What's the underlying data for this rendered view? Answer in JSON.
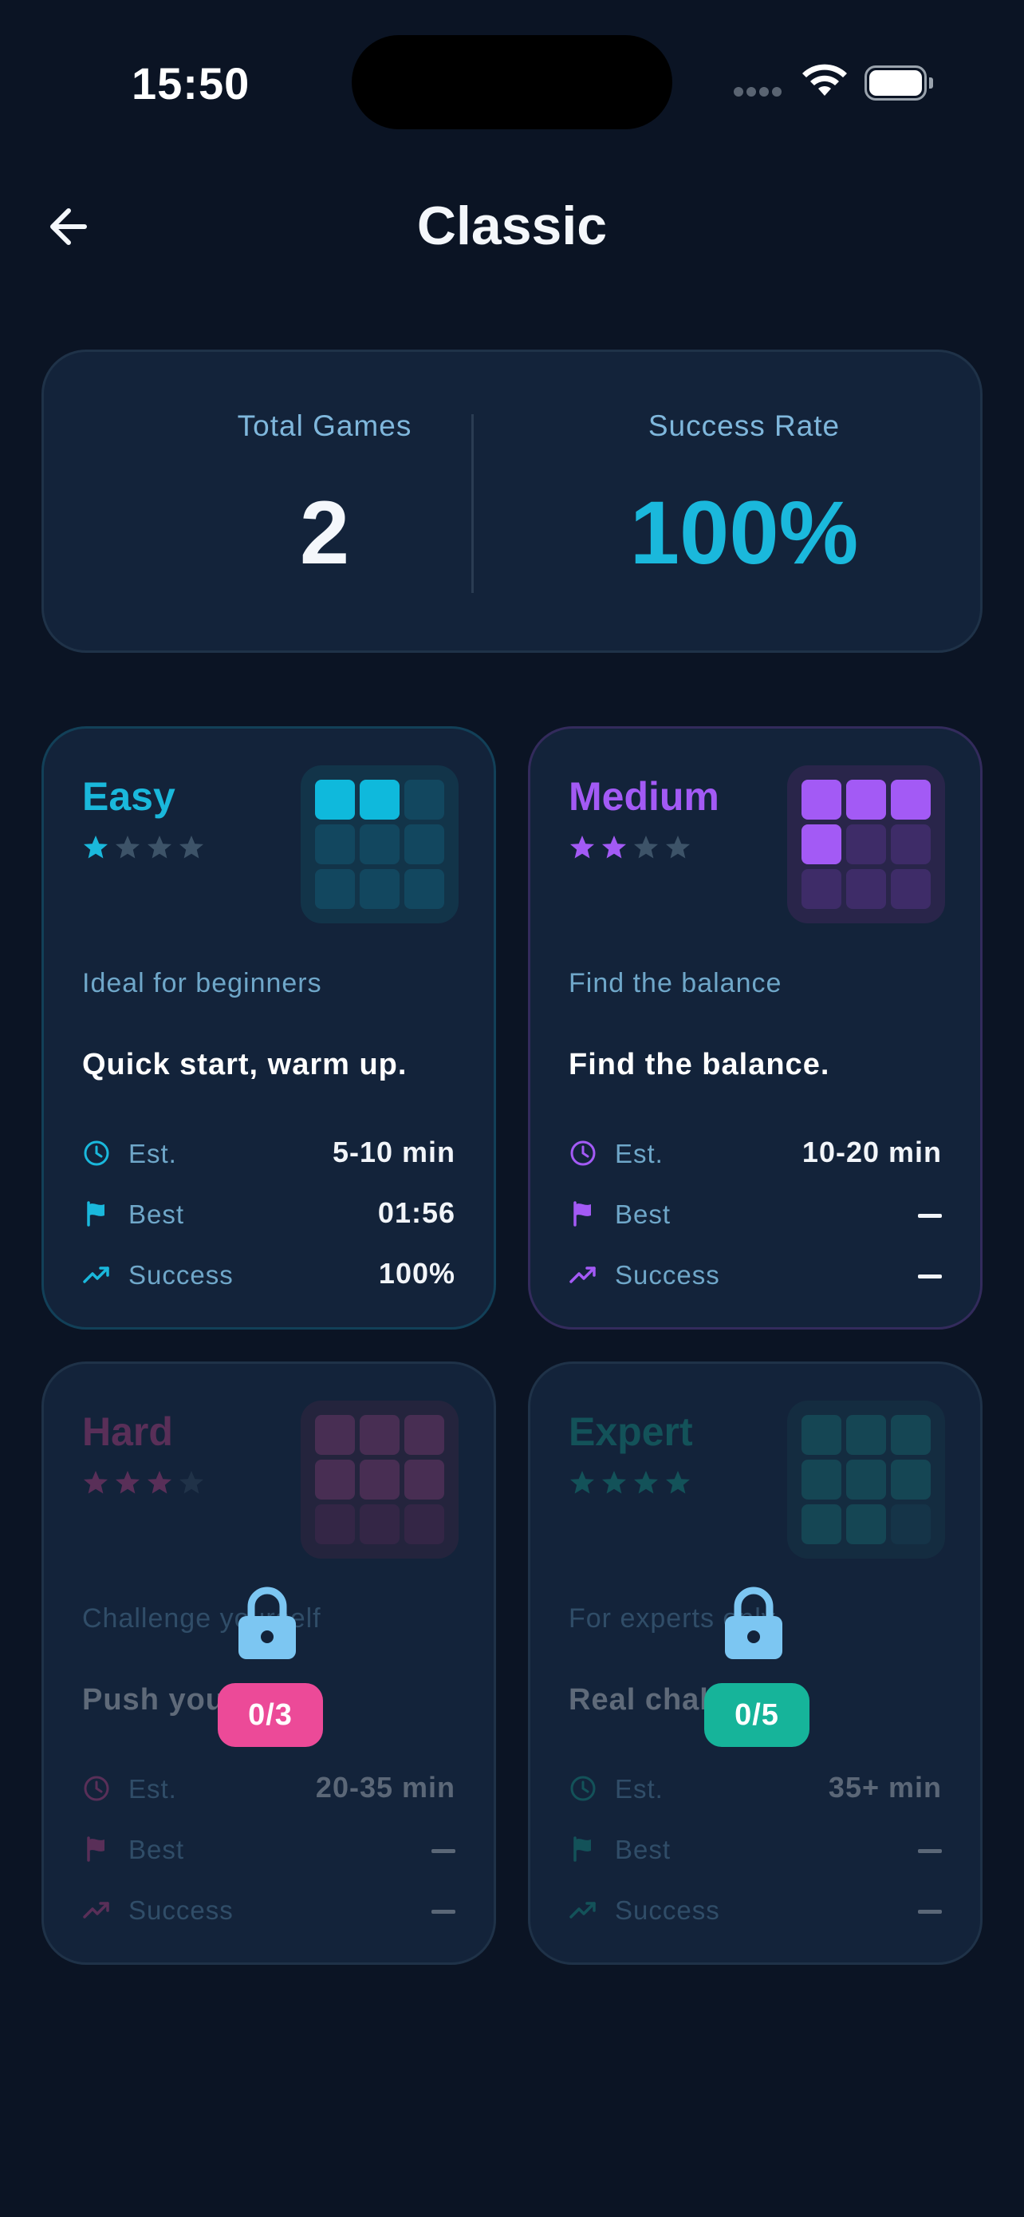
{
  "status_bar": {
    "time": "15:50"
  },
  "header": {
    "title": "Classic"
  },
  "summary": {
    "total_games_label": "Total Games",
    "total_games_value": "2",
    "success_rate_label": "Success Rate",
    "success_rate_value": "100%"
  },
  "levels": [
    {
      "name": "Easy",
      "stars": 1,
      "total_stars": 4,
      "tagline": "Ideal for beginners",
      "description": "Quick start, warm up.",
      "est_label": "Est.",
      "est_value": "5-10 min",
      "best_label": "Best",
      "best_value": "01:56",
      "success_label": "Success",
      "success_value": "100%",
      "locked": false,
      "accent": "#1ab8dc"
    },
    {
      "name": "Medium",
      "stars": 2,
      "total_stars": 4,
      "tagline": "Find the balance",
      "description": "Find the balance.",
      "est_label": "Est.",
      "est_value": "10-20 min",
      "best_label": "Best",
      "best_value": "—",
      "success_label": "Success",
      "success_value": "—",
      "locked": false,
      "accent": "#a35af5"
    },
    {
      "name": "Hard",
      "stars": 3,
      "total_stars": 4,
      "tagline": "Challenge yourself",
      "description": "Push yourself.",
      "est_label": "Est.",
      "est_value": "20-35 min",
      "best_label": "Best",
      "best_value": "—",
      "success_label": "Success",
      "success_value": "—",
      "locked": true,
      "unlock_progress": "0/3",
      "accent": "#ec4a98"
    },
    {
      "name": "Expert",
      "stars": 4,
      "total_stars": 4,
      "tagline": "For experts only",
      "description": "Real challenge.",
      "est_label": "Est.",
      "est_value": "35+ min",
      "best_label": "Best",
      "best_value": "—",
      "success_label": "Success",
      "success_value": "—",
      "locked": true,
      "unlock_progress": "0/5",
      "accent": "#16b49a"
    }
  ],
  "colors": {
    "background": "#0b1424",
    "card": "#13233a",
    "label_blue": "#7fb7dc",
    "success_value": "#1ab8dc",
    "lock_icon": "#7cc6f2"
  },
  "icons": {
    "back": "arrow-left-icon",
    "est": "clock-icon",
    "best": "flag-icon",
    "success": "trend-up-icon",
    "lock": "lock-icon",
    "star": "star-icon"
  }
}
